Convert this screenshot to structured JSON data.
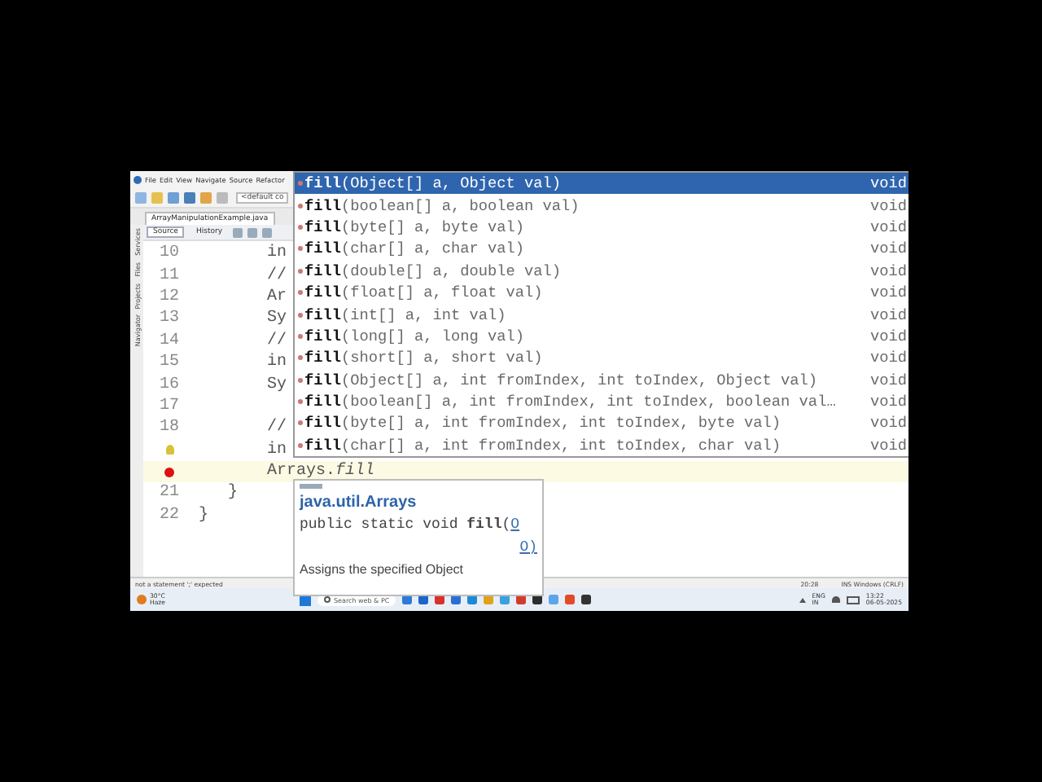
{
  "menu": [
    "File",
    "Edit",
    "View",
    "Navigate",
    "Source",
    "Refactor"
  ],
  "config_field": {
    "value": "<default co"
  },
  "editor_tab": {
    "title": "ArrayManipulationExample.java"
  },
  "view_tabs": [
    {
      "label": "Source",
      "selected": true
    },
    {
      "label": "History",
      "selected": false
    }
  ],
  "side_panels": [
    "Services",
    "Files",
    "Projects",
    "Navigator"
  ],
  "code_lines": [
    {
      "number": "10",
      "kind": "plain",
      "current": false,
      "text": "        in"
    },
    {
      "number": "11",
      "kind": "plain",
      "current": false,
      "text": "        //"
    },
    {
      "number": "12",
      "kind": "plain",
      "current": false,
      "text": "        Ar"
    },
    {
      "number": "13",
      "kind": "plain",
      "current": false,
      "text": "        Sy"
    },
    {
      "number": "14",
      "kind": "plain",
      "current": false,
      "text": "        //"
    },
    {
      "number": "15",
      "kind": "plain",
      "current": false,
      "text": "        in"
    },
    {
      "number": "16",
      "kind": "plain",
      "current": false,
      "text": "        Sy"
    },
    {
      "number": "17",
      "kind": "plain",
      "current": false
    },
    {
      "number": "18",
      "kind": "plain",
      "current": false,
      "text": "        //"
    },
    {
      "kind": "hint",
      "current": false,
      "text": "        in"
    },
    {
      "kind": "error",
      "current": true,
      "text": "        Arrays.*fill*"
    },
    {
      "number": "21",
      "kind": "plain",
      "current": false,
      "text": "    }"
    },
    {
      "number": "22",
      "kind": "plain",
      "current": false,
      "text": " }"
    }
  ],
  "completion": [
    {
      "name": "fill",
      "params": "(Object[] a, Object val)",
      "type": "void",
      "selected": true
    },
    {
      "name": "fill",
      "params": "(boolean[] a, boolean val)",
      "type": "void",
      "selected": false
    },
    {
      "name": "fill",
      "params": "(byte[] a, byte val)",
      "type": "void",
      "selected": false
    },
    {
      "name": "fill",
      "params": "(char[] a, char val)",
      "type": "void",
      "selected": false
    },
    {
      "name": "fill",
      "params": "(double[] a, double val)",
      "type": "void",
      "selected": false
    },
    {
      "name": "fill",
      "params": "(float[] a, float val)",
      "type": "void",
      "selected": false
    },
    {
      "name": "fill",
      "params": "(int[] a, int val)",
      "type": "void",
      "selected": false
    },
    {
      "name": "fill",
      "params": "(long[] a, long val)",
      "type": "void",
      "selected": false
    },
    {
      "name": "fill",
      "params": "(short[] a, short val)",
      "type": "void",
      "selected": false
    },
    {
      "name": "fill",
      "params": "(Object[] a, int fromIndex, int toIndex, Object val)",
      "type": "void",
      "selected": false
    },
    {
      "name": "fill",
      "params": "(boolean[] a, int fromIndex, int toIndex, boolean val…",
      "type": "void",
      "selected": false
    },
    {
      "name": "fill",
      "params": "(byte[] a, int fromIndex, int toIndex, byte val)",
      "type": "void",
      "selected": false
    },
    {
      "name": "fill",
      "params": "(char[] a, int fromIndex, int toIndex, char val)",
      "type": "void",
      "selected": false
    }
  ],
  "javadoc": {
    "class": "java.util.Arrays",
    "signature": "public static void **fill**(",
    "link_1": "O",
    "link_2": "O)",
    "description": "Assigns the specified Object"
  },
  "status": {
    "message": "not a statement  ';' expected",
    "position": "20:28",
    "mode": "INS Windows (CRLF)"
  },
  "taskbar": {
    "temperature": "30°C",
    "weather": "Haze",
    "search_placeholder": "Search web & PC",
    "language": "ENG",
    "region": "IN",
    "time": "13:22",
    "date": "06-05-2025"
  }
}
